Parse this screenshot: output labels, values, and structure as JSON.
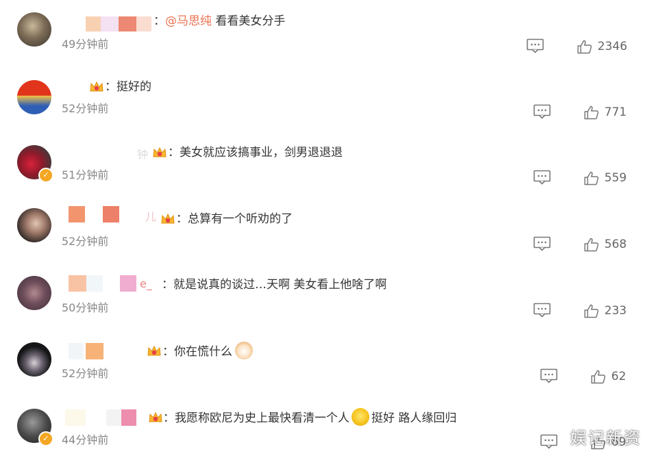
{
  "comments": [
    {
      "mention": "@马思纯",
      "text": "看看美女分手",
      "time": "49分钟前",
      "likes": "2346",
      "verified": false
    },
    {
      "mention": "",
      "text": "挺好的",
      "time": "52分钟前",
      "likes": "771",
      "verified": false
    },
    {
      "mention": "",
      "text": "美女就应该搞事业，剑男退退退",
      "time": "51分钟前",
      "likes": "559",
      "verified": true
    },
    {
      "mention": "",
      "text": "总算有一个听劝的了",
      "time": "52分钟前",
      "likes": "568",
      "verified": false
    },
    {
      "mention": "",
      "text": "就是说真的谈过…天啊 美女看上他啥了啊",
      "time": "50分钟前",
      "likes": "233",
      "verified": false
    },
    {
      "mention": "",
      "text": "你在慌什么",
      "time": "52分钟前",
      "likes": "62",
      "verified": false
    },
    {
      "mention": "",
      "text": "我愿称欧尼为史上最快看清一个人",
      "text2": "挺好 路人缘回归",
      "time": "44分钟前",
      "likes": "69",
      "verified": true
    }
  ],
  "name_fragments": {
    "c3": "钟",
    "c4": "儿",
    "c5": "e_"
  },
  "separator": "：",
  "watermark": "娱记新资",
  "colors": {
    "mention": "#eb7350",
    "time": "#888888",
    "text": "#333333",
    "verified": "#f5a623"
  }
}
